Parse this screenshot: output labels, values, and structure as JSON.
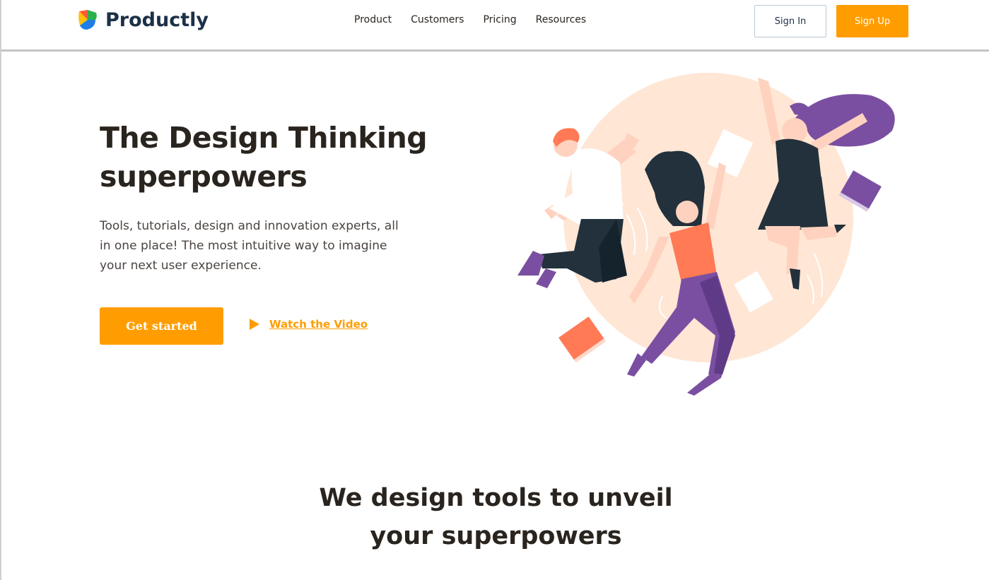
{
  "brand": {
    "name": "Productly",
    "logo_colors": [
      "#ff5a36",
      "#ffc107",
      "#2ab24a",
      "#1e7ee6"
    ]
  },
  "nav": {
    "items": [
      {
        "label": "Product"
      },
      {
        "label": "Customers"
      },
      {
        "label": "Pricing"
      },
      {
        "label": "Resources"
      }
    ]
  },
  "auth": {
    "sign_in": "Sign In",
    "sign_up": "Sign Up"
  },
  "hero": {
    "title_line1": "The Design Thinking",
    "title_line2": "superpowers",
    "subtitle_line1": "Tools, tutorials, design and innovation experts, all",
    "subtitle_line2": "in one place! The most intuitive way to imagine",
    "subtitle_line3": "your next user experience.",
    "cta_primary": "Get started",
    "cta_video": "Watch the Video",
    "cta_video_icon": "play-icon"
  },
  "section": {
    "title_line1": "We design tools to unveil",
    "title_line2": "your superpowers"
  },
  "colors": {
    "accent": "#ff9d00",
    "heading": "#2a241f",
    "brand_text": "#1c3047",
    "illustration_circle": "#ffe6d5",
    "purple": "#7a4fa1",
    "coral": "#ff7a55",
    "dark": "#22313b"
  },
  "illustration": {
    "name": "three people jumping with papers and books"
  }
}
